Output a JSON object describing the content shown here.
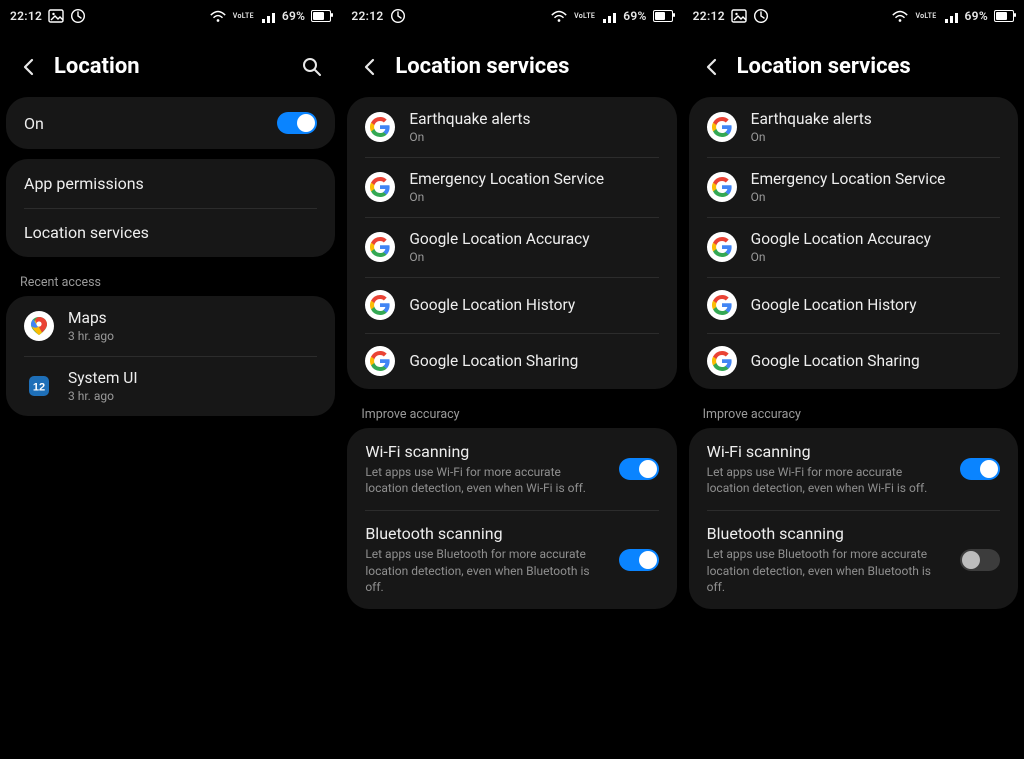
{
  "status": {
    "time": "22:12",
    "lte": "VoLTE",
    "battery_pct": "69%"
  },
  "p1": {
    "title": "Location",
    "master": {
      "label": "On",
      "on": true
    },
    "items": [
      {
        "label": "App permissions"
      },
      {
        "label": "Location services"
      }
    ],
    "recent_label": "Recent access",
    "recent": [
      {
        "name": "Maps",
        "sub": "3 hr. ago"
      },
      {
        "name": "System UI",
        "sub": "3 hr. ago"
      }
    ]
  },
  "p2": {
    "title": "Location services",
    "services": [
      {
        "label": "Earthquake alerts",
        "sub": "On"
      },
      {
        "label": "Emergency Location Service",
        "sub": "On"
      },
      {
        "label": "Google Location Accuracy",
        "sub": "On"
      },
      {
        "label": "Google Location History",
        "sub": ""
      },
      {
        "label": "Google Location Sharing",
        "sub": ""
      }
    ],
    "improve_label": "Improve accuracy",
    "scan": [
      {
        "label": "Wi-Fi scanning",
        "desc": "Let apps use Wi-Fi for more accurate location detection, even when Wi-Fi is off.",
        "on": true
      },
      {
        "label": "Bluetooth scanning",
        "desc": "Let apps use Bluetooth for more accurate location detection, even when Bluetooth is off.",
        "on": true
      }
    ]
  },
  "p3": {
    "title": "Location services",
    "services": [
      {
        "label": "Earthquake alerts",
        "sub": "On"
      },
      {
        "label": "Emergency Location Service",
        "sub": "On"
      },
      {
        "label": "Google Location Accuracy",
        "sub": "On"
      },
      {
        "label": "Google Location History",
        "sub": ""
      },
      {
        "label": "Google Location Sharing",
        "sub": ""
      }
    ],
    "improve_label": "Improve accuracy",
    "scan": [
      {
        "label": "Wi-Fi scanning",
        "desc": "Let apps use Wi-Fi for more accurate location detection, even when Wi-Fi is off.",
        "on": true
      },
      {
        "label": "Bluetooth scanning",
        "desc": "Let apps use Bluetooth for more accurate location detection, even when Bluetooth is off.",
        "on": false
      }
    ]
  }
}
